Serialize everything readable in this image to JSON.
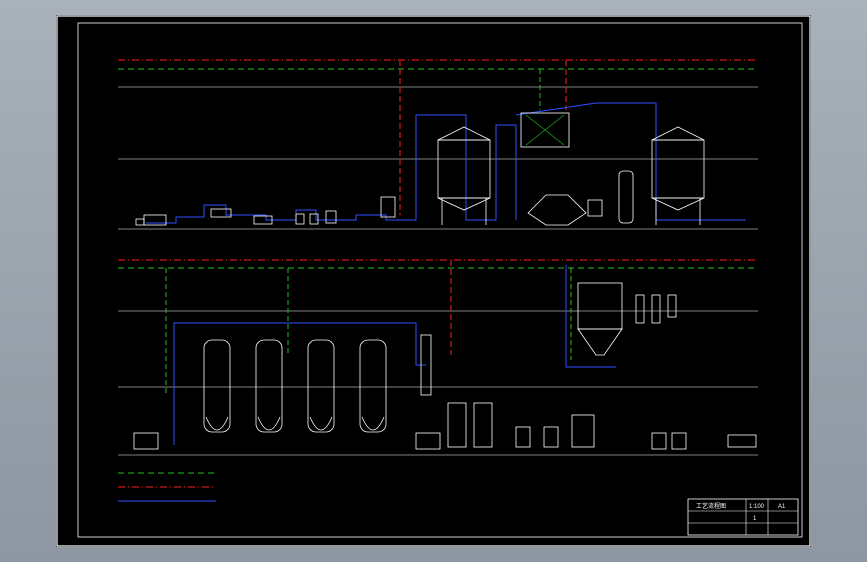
{
  "drawing": {
    "title_block": {
      "title": "工艺流程图",
      "scale": "1:100",
      "sheet": "1",
      "size": "A1"
    }
  },
  "colors": {
    "background": "#000000",
    "frame": "#ffffff",
    "steam_line": "#ff2020",
    "water_line": "#20c020",
    "material_line": "#3050ff",
    "level_line": "#ffffff"
  }
}
